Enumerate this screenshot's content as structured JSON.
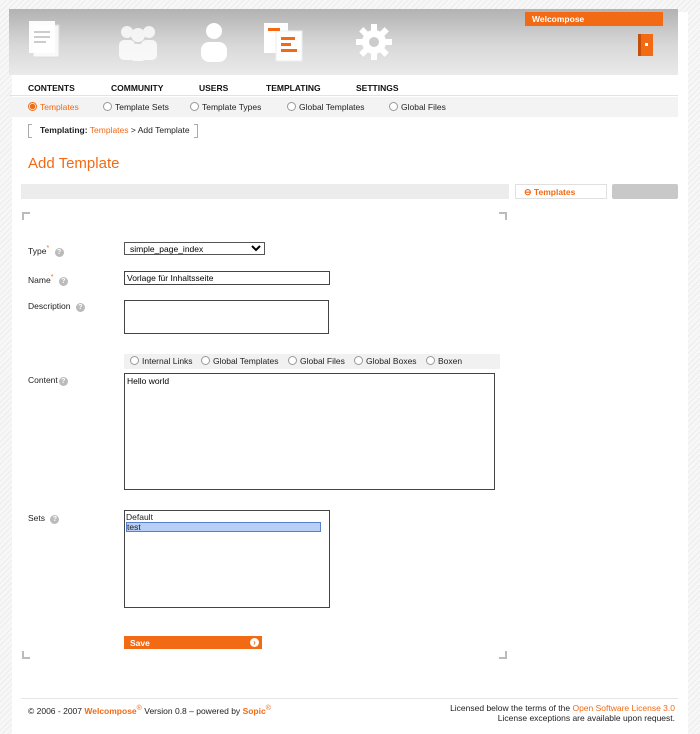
{
  "header": {
    "brand": "Welcompose",
    "icons": [
      "contents-icon",
      "community-icon",
      "users-icon",
      "templating-icon",
      "settings-icon"
    ]
  },
  "mainnav": [
    "CONTENTS",
    "COMMUNITY",
    "USERS",
    "TEMPLATING",
    "SETTINGS"
  ],
  "subnav": [
    "Templates",
    "Template Sets",
    "Template Types",
    "Global Templates",
    "Global Files"
  ],
  "breadcrumb": {
    "section": "Templating",
    "sep": ":",
    "link": "Templates",
    "current": "> Add Template"
  },
  "page_title": "Add Template",
  "toolbar": {
    "templates_button": "Templates"
  },
  "form": {
    "type_label": "Type",
    "type_value": "simple_page_index",
    "name_label": "Name",
    "name_value": "Vorlage für Inhaltsseite",
    "description_label": "Description",
    "description_value": "",
    "content_label": "Content",
    "content_value": "Hello world",
    "insert_options": [
      "Internal Links",
      "Global Templates",
      "Global Files",
      "Global Boxes",
      "Boxen"
    ],
    "sets_label": "Sets",
    "sets_options": [
      "Default",
      "test"
    ],
    "sets_selected": "test",
    "required_mark": "*",
    "help_mark": "?",
    "save_label": "Save"
  },
  "footer": {
    "copyright": "© 2006 - 2007",
    "product": "Welcompose",
    "version": "Version 0.8 – powered by",
    "company": "Sopic",
    "reg": "®",
    "license_prefix": "Licensed below the terms of the",
    "license_link": "Open Software License 3.0",
    "license_line2": "License exceptions are available upon request."
  },
  "colors": {
    "accent": "#f26a14"
  }
}
